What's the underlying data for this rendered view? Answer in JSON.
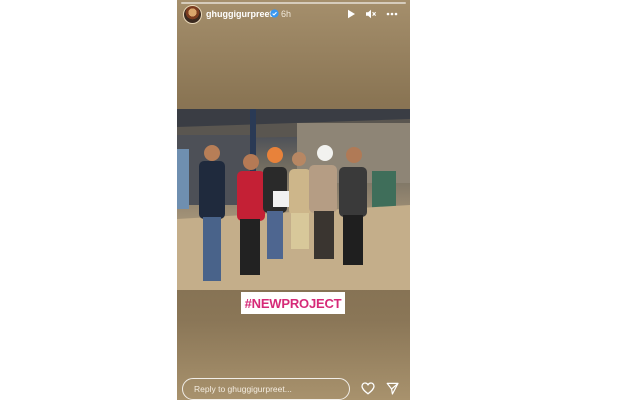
{
  "story": {
    "username": "ghuggigurpreet",
    "time": "6h",
    "sticker_text": "#NEWPROJECT",
    "reply_placeholder": "Reply to ghuggigurpreet..."
  },
  "icons": {
    "verified": "verified-badge-icon",
    "play": "play-icon",
    "mute": "muted-speaker-icon",
    "more": "more-options-icon",
    "like": "heart-icon",
    "share": "send-icon"
  },
  "colors": {
    "sticker_text": "#d62a78",
    "verified_badge": "#3897f0"
  }
}
